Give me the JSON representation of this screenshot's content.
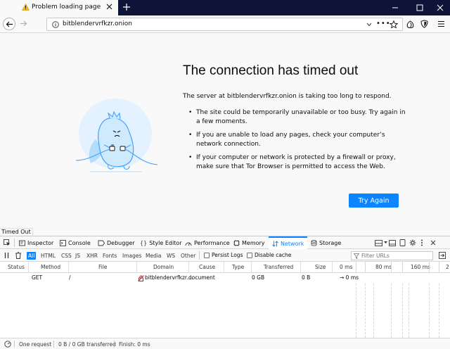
{
  "browser": {
    "tab_title": "Problem loading page",
    "url": "bitblendervrfkzr.onion",
    "page_actions_glyph": "•••",
    "colors": {
      "titlebar": "#0d1438",
      "accent": "#0a84ff"
    }
  },
  "error_page": {
    "title": "The connection has timed out",
    "description": "The server at bitblendervrfkzr.onion is taking too long to respond.",
    "bullets": [
      "The site could be temporarily unavailable or too busy. Try again in a few moments.",
      "If you are unable to load any pages, check your computer’s network connection.",
      "If your computer or network is protected by a firewall or proxy, make sure that Tor Browser is permitted to access the Web."
    ],
    "try_again_label": "Try Again"
  },
  "status_overlay": "Timed Out",
  "devtools": {
    "tabs": [
      {
        "label": "Inspector",
        "icon": "inspector-icon"
      },
      {
        "label": "Console",
        "icon": "console-icon"
      },
      {
        "label": "Debugger",
        "icon": "debugger-icon"
      },
      {
        "label": "Style Editor",
        "icon": "style-editor-icon"
      },
      {
        "label": "Performance",
        "icon": "performance-icon"
      },
      {
        "label": "Memory",
        "icon": "memory-icon"
      },
      {
        "label": "Network",
        "icon": "network-icon",
        "active": true
      },
      {
        "label": "Storage",
        "icon": "storage-icon"
      }
    ],
    "filters": [
      "All",
      "HTML",
      "CSS",
      "JS",
      "XHR",
      "Fonts",
      "Images",
      "Media",
      "WS",
      "Other"
    ],
    "persist_logs_label": "Persist Logs",
    "disable_cache_label": "Disable cache",
    "filter_placeholder": "Filter URLs",
    "columns": {
      "status": "Status",
      "method": "Method",
      "file": "File",
      "domain": "Domain",
      "cause": "Cause",
      "type": "Type",
      "transferred": "Transferred",
      "size": "Size"
    },
    "waterfall_ticks": [
      "0 ms",
      "80 ms",
      "160 ms",
      "2"
    ],
    "request": {
      "method": "GET",
      "file": "/",
      "domain": "bitblendervrfkzr....",
      "cause": "document",
      "transferred": "0 GB",
      "size": "0 B",
      "timing": "→ 0 ms"
    },
    "status_bar": {
      "requests": "One request",
      "transferred": "0 B / 0 GB transferred",
      "finish": "Finish: 0 ms"
    }
  }
}
